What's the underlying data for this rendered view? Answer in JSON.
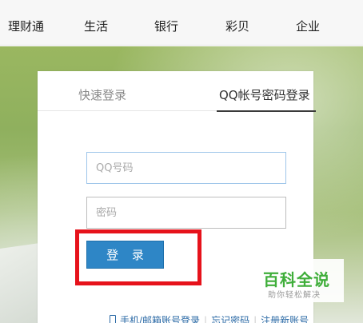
{
  "nav": {
    "items": [
      {
        "label": "理财通"
      },
      {
        "label": "生活"
      },
      {
        "label": "银行"
      },
      {
        "label": "彩贝"
      },
      {
        "label": "企业"
      }
    ]
  },
  "login": {
    "tabs": [
      {
        "label": "快速登录",
        "active": false
      },
      {
        "label": "QQ帐号密码登录",
        "active": true
      }
    ],
    "qq_field": {
      "value": "",
      "placeholder": "QQ号码"
    },
    "password_field": {
      "value": "",
      "placeholder": "密码"
    },
    "login_button": "登 录",
    "links": {
      "phone_email": "手机/邮箱账号登录",
      "forgot": "忘记密码",
      "register": "注册新账号"
    }
  },
  "watermark": {
    "title": "百科全说",
    "subtitle": "助你轻松解决"
  },
  "colors": {
    "highlight": "#e6121b",
    "button": "#2e86c6",
    "link": "#2b6aa6",
    "watermark_green": "#3fae3a"
  },
  "icons": [
    "phone-icon"
  ]
}
